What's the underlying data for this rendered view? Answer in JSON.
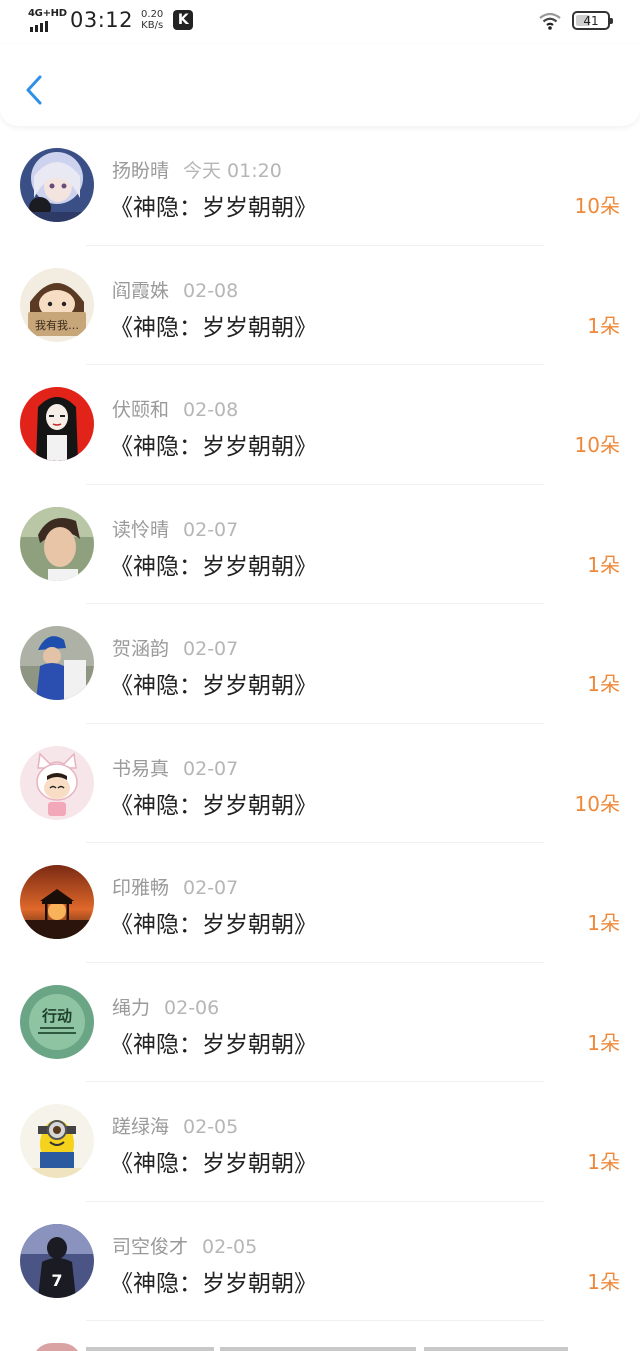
{
  "status_bar": {
    "network": "4G+HD",
    "time": "03:12",
    "speed_value": "0.20",
    "speed_unit": "KB/s",
    "badge": "K",
    "battery": "41"
  },
  "nav": {
    "back_icon": "chevron-left-icon"
  },
  "accent_color": "#f0883a",
  "items": [
    {
      "name": "扬盼晴",
      "date": "今天 01:20",
      "title": "《神隐：岁岁朝朝》",
      "count": "10朵"
    },
    {
      "name": "阎霞姝",
      "date": "02-08",
      "title": "《神隐：岁岁朝朝》",
      "count": "1朵"
    },
    {
      "name": "伏颐和",
      "date": "02-08",
      "title": "《神隐：岁岁朝朝》",
      "count": "10朵"
    },
    {
      "name": "读怜晴",
      "date": "02-07",
      "title": "《神隐：岁岁朝朝》",
      "count": "1朵"
    },
    {
      "name": "贺涵韵",
      "date": "02-07",
      "title": "《神隐：岁岁朝朝》",
      "count": "1朵"
    },
    {
      "name": "书易真",
      "date": "02-07",
      "title": "《神隐：岁岁朝朝》",
      "count": "10朵"
    },
    {
      "name": "印雅畅",
      "date": "02-07",
      "title": "《神隐：岁岁朝朝》",
      "count": "1朵"
    },
    {
      "name": "绳力",
      "date": "02-06",
      "title": "《神隐：岁岁朝朝》",
      "count": "1朵"
    },
    {
      "name": "蹉绿海",
      "date": "02-05",
      "title": "《神隐：岁岁朝朝》",
      "count": "1朵"
    },
    {
      "name": "司空俊才",
      "date": "02-05",
      "title": "《神隐：岁岁朝朝》",
      "count": "1朵"
    }
  ],
  "avatar_texts": {
    "a2": "我有我…",
    "a8": "行动",
    "a10": "7"
  }
}
